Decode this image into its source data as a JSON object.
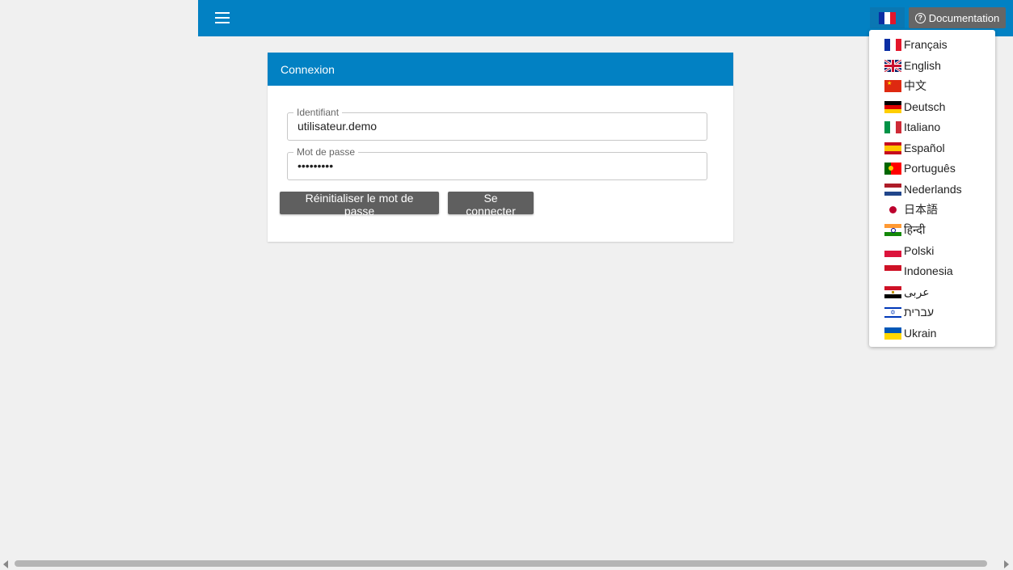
{
  "toolbar": {
    "menu_icon": "hamburger-menu-icon",
    "current_language_flag": "france-flag",
    "documentation_label": "Documentation",
    "documentation_icon": "help-circle-icon"
  },
  "login": {
    "title": "Connexion",
    "username_label": "Identifiant",
    "username_value": "utilisateur.demo",
    "password_label": "Mot de passe",
    "password_value": "•••••••••",
    "reset_button": "Réinitialiser le mot de passe",
    "login_button": "Se connecter"
  },
  "languages": [
    {
      "label": "Français",
      "flag": "fr"
    },
    {
      "label": "English",
      "flag": "gb"
    },
    {
      "label": "中文",
      "flag": "cn"
    },
    {
      "label": "Deutsch",
      "flag": "de"
    },
    {
      "label": "Italiano",
      "flag": "it"
    },
    {
      "label": "Español",
      "flag": "es"
    },
    {
      "label": "Português",
      "flag": "pt"
    },
    {
      "label": "Nederlands",
      "flag": "nl"
    },
    {
      "label": "日本語",
      "flag": "jp"
    },
    {
      "label": "हिन्दी",
      "flag": "in"
    },
    {
      "label": "Polski",
      "flag": "pl"
    },
    {
      "label": "Indonesia",
      "flag": "id"
    },
    {
      "label": "عربى",
      "flag": "eg"
    },
    {
      "label": "עברית",
      "flag": "il"
    },
    {
      "label": "Ukrain",
      "flag": "ua"
    }
  ],
  "colors": {
    "header_blue": "#0281c3",
    "button_gray": "#5f5f5f",
    "background": "#f0f0f0"
  }
}
